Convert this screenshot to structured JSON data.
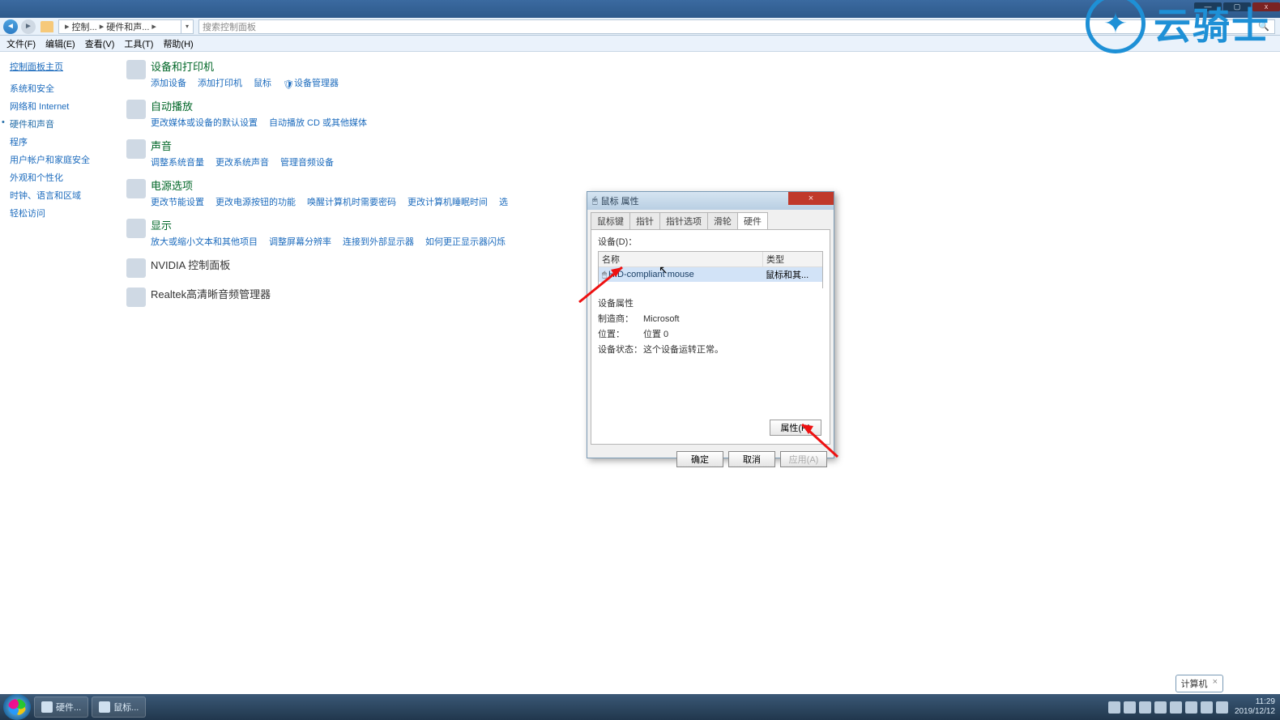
{
  "window_controls": {
    "minimize": "—",
    "maximize": "▢",
    "close": "x"
  },
  "breadcrumb": {
    "item1": "控制...",
    "item2": "硬件和声..."
  },
  "search": {
    "placeholder": "搜索控制面板"
  },
  "menus": {
    "file": "文件(F)",
    "edit": "编辑(E)",
    "view": "查看(V)",
    "tools": "工具(T)",
    "help": "帮助(H)"
  },
  "sidebar": {
    "home": "控制面板主页",
    "items": [
      "系统和安全",
      "网络和 Internet",
      "硬件和声音",
      "程序",
      "用户帐户和家庭安全",
      "外观和个性化",
      "时钟、语言和区域",
      "轻松访问"
    ],
    "active_index": 2
  },
  "sections": [
    {
      "title": "设备和打印机",
      "links": [
        "添加设备",
        "添加打印机",
        "鼠标",
        "设备管理器"
      ],
      "shield_index": 3
    },
    {
      "title": "自动播放",
      "links": [
        "更改媒体或设备的默认设置",
        "自动播放 CD 或其他媒体"
      ]
    },
    {
      "title": "声音",
      "links": [
        "调整系统音量",
        "更改系统声音",
        "管理音频设备"
      ]
    },
    {
      "title": "电源选项",
      "links": [
        "更改节能设置",
        "更改电源按钮的功能",
        "唤醒计算机时需要密码",
        "更改计算机睡眠时间",
        "选"
      ]
    },
    {
      "title": "显示",
      "links": [
        "放大或缩小文本和其他项目",
        "调整屏幕分辨率",
        "连接到外部显示器",
        "如何更正显示器闪烁"
      ]
    }
  ],
  "plain_sections": [
    {
      "title": "NVIDIA 控制面板"
    },
    {
      "title": "Realtek高清晰音频管理器"
    }
  ],
  "dialog": {
    "title": "鼠标 属性",
    "tabs": [
      "鼠标键",
      "指针",
      "指针选项",
      "滑轮",
      "硬件"
    ],
    "active_tab": 4,
    "devices_label": "设备(D)：",
    "columns": {
      "name": "名称",
      "type": "类型"
    },
    "row": {
      "name": "HID-compliant mouse",
      "type": "鼠标和其..."
    },
    "props": {
      "header": "设备属性",
      "maker_label": "制造商：",
      "maker": "Microsoft",
      "loc_label": "位置：",
      "loc": "位置 0",
      "status_label": "设备状态：",
      "status": "这个设备运转正常。"
    },
    "prop_button": "属性(R)",
    "buttons": {
      "ok": "确定",
      "cancel": "取消",
      "apply": "应用(A)"
    }
  },
  "taskbar": {
    "btn1": "硬件...",
    "btn2": "鼠标...",
    "speech": "计算机",
    "speech_close": "×",
    "clock_time": "11:29",
    "clock_date": "2019/12/12"
  },
  "watermark": "云骑士"
}
